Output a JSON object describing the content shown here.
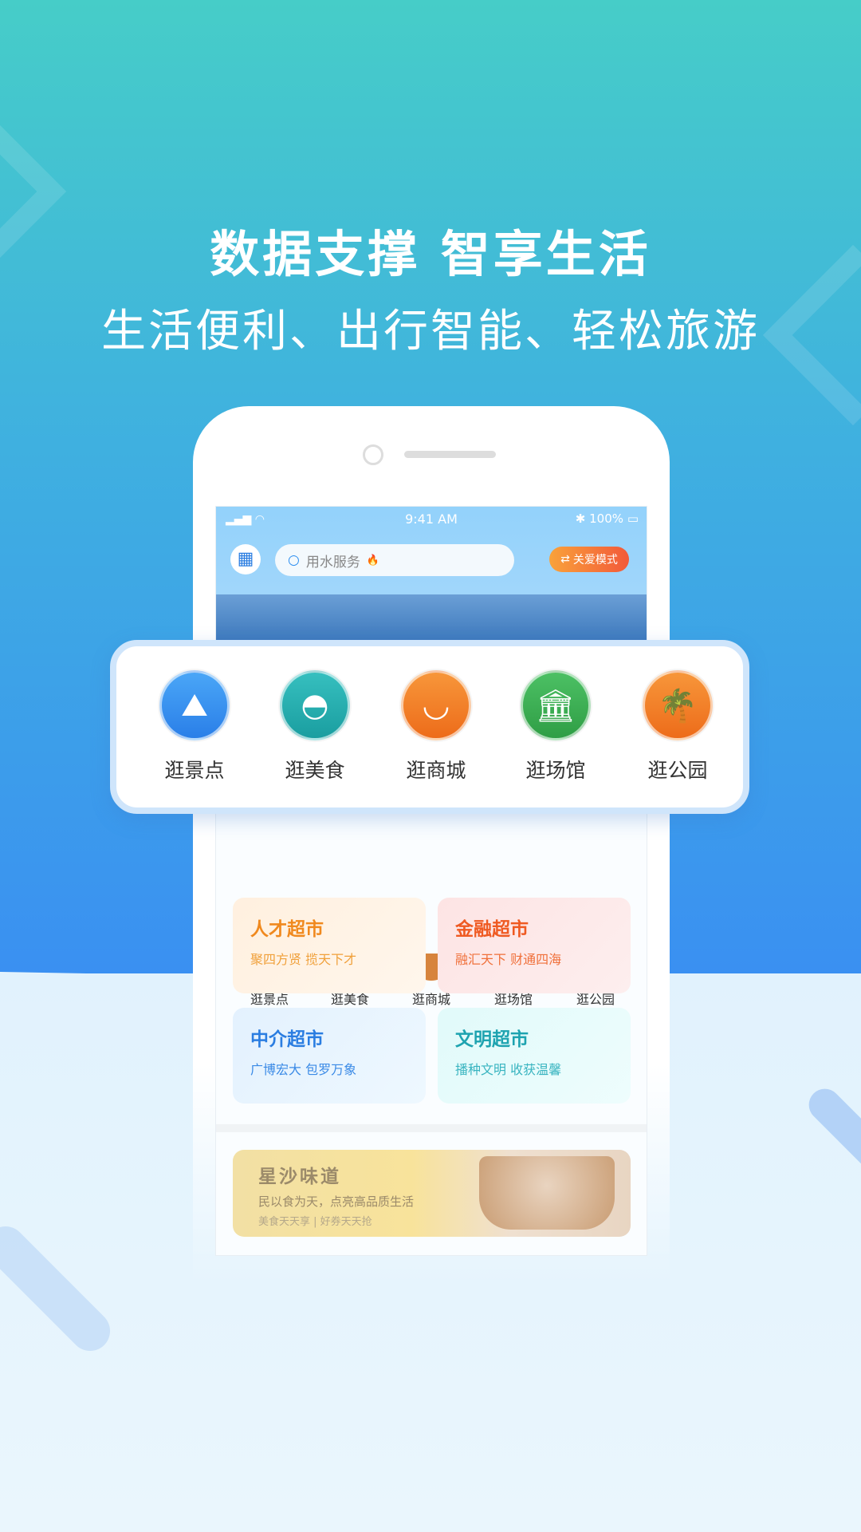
{
  "headline": {
    "title": "数据支撑  智享生活",
    "subtitle": "生活便利、出行智能、轻松旅游"
  },
  "status_bar": {
    "time": "9:41 AM",
    "battery": "100%"
  },
  "app": {
    "logo_icon": "city-logo-icon",
    "search_placeholder": "用水服务",
    "care_mode_label": "关爱模式",
    "categories": [
      {
        "label": "逛景点",
        "icon": "mountain-icon",
        "color": "#2f8ff0"
      },
      {
        "label": "逛美食",
        "icon": "food-cloche-icon",
        "color": "#1fa6a8"
      },
      {
        "label": "逛商城",
        "icon": "shopping-basket-icon",
        "color": "#f07a22"
      },
      {
        "label": "逛场馆",
        "icon": "museum-icon",
        "color": "#35ab4e"
      },
      {
        "label": "逛公园",
        "icon": "palm-tree-icon",
        "color": "#ef7822"
      }
    ],
    "cards": [
      {
        "title": "人才超市",
        "subtitle": "聚四方贤  揽天下才",
        "color": "#f0891e",
        "bg": "#fff1e2"
      },
      {
        "title": "金融超市",
        "subtitle": "融汇天下  财通四海",
        "color": "#ef5a22",
        "bg": "#fde6e6"
      },
      {
        "title": "中介超市",
        "subtitle": "广博宏大  包罗万象",
        "color": "#2a7de1",
        "bg": "#e6f3fe"
      },
      {
        "title": "文明超市",
        "subtitle": "播种文明  收获温馨",
        "color": "#1ea3b0",
        "bg": "#e4fbfb"
      }
    ],
    "food_banner": {
      "title": "星沙味道",
      "subtitle": "民以食为天，点亮高品质生活",
      "tagline": "美食天天享 | 好券天天抢"
    }
  }
}
